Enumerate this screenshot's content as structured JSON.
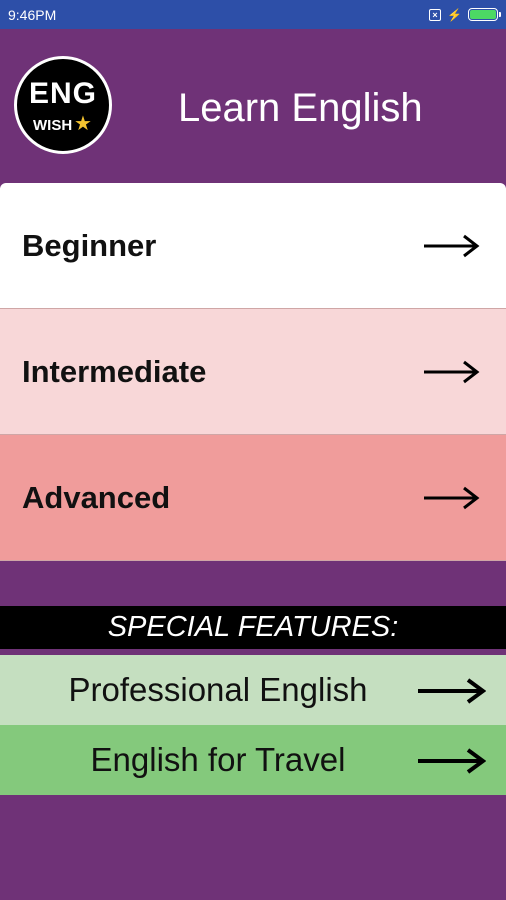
{
  "status_bar": {
    "time": "9:46PM",
    "icons": [
      "sim-icon",
      "charging-icon",
      "battery-icon"
    ],
    "battery_color": "#4cd964"
  },
  "header": {
    "logo": {
      "line1": "ENG",
      "line2": "WISH",
      "accent_icon": "star-icon"
    },
    "title": "Learn English",
    "background": "#6f3277"
  },
  "levels": [
    {
      "label": "Beginner",
      "color": "#ffffff",
      "icon": "arrow-right-icon"
    },
    {
      "label": "Intermediate",
      "color": "#f8d7d8",
      "icon": "arrow-right-icon"
    },
    {
      "label": "Advanced",
      "color": "#f09c9b",
      "icon": "arrow-right-icon"
    }
  ],
  "special": {
    "heading": "SPECIAL FEATURES:",
    "items": [
      {
        "label": "Professional English",
        "color": "#c5dfc0",
        "icon": "arrow-right-icon"
      },
      {
        "label": "English for Travel",
        "color": "#84c97c",
        "icon": "arrow-right-icon"
      }
    ]
  }
}
